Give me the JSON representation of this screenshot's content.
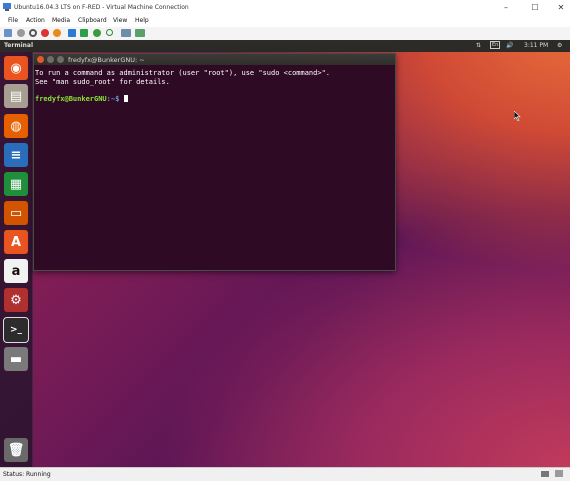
{
  "window": {
    "title": "Ubuntu16.04.3 LTS on F-RED - Virtual Machine Connection",
    "minimize": "–",
    "maximize": "☐",
    "close": "✕"
  },
  "menu": [
    "File",
    "Action",
    "Media",
    "Clipboard",
    "View",
    "Help"
  ],
  "guest_panel": {
    "app_name": "Terminal",
    "keyboard_layout": "En",
    "time": "3:11 PM",
    "network_glyph": "⇅",
    "volume_glyph": "🔊",
    "gear_glyph": "⚙"
  },
  "terminal": {
    "title": "fredyfx@BunkerGNU: ~",
    "line1": "To run a command as administrator (user \"root\"), use \"sudo <command>\".",
    "line2": "See \"man sudo_root\" for details.",
    "prompt_user": "fredyfx@BunkerGNU",
    "prompt_path": ":~$"
  },
  "launcher": [
    {
      "name": "ubuntu-dash",
      "glyph": "◉",
      "color": "#e95420"
    },
    {
      "name": "files",
      "glyph": "▤",
      "color": "#a89f93"
    },
    {
      "name": "firefox",
      "glyph": "◍",
      "color": "#e66000"
    },
    {
      "name": "writer",
      "glyph": "≡",
      "color": "#2a6ebb"
    },
    {
      "name": "calc",
      "glyph": "▦",
      "color": "#1f8f3a"
    },
    {
      "name": "impress",
      "glyph": "▭",
      "color": "#d35400"
    },
    {
      "name": "software",
      "glyph": "A",
      "color": "#e95420"
    },
    {
      "name": "amazon",
      "glyph": "a",
      "color": "#f2f2f2"
    },
    {
      "name": "settings",
      "glyph": "⚙",
      "color": "#b03030"
    },
    {
      "name": "terminal",
      "glyph": ">_",
      "color": "#2c2c2c"
    },
    {
      "name": "drive",
      "glyph": "▬",
      "color": "#7a7a7a"
    }
  ],
  "trash_glyph": "🗑",
  "status": {
    "text": "Status: Running"
  },
  "colors": {
    "ubuntu_orange": "#e95420",
    "terminal_bg": "#2f0a24",
    "prompt_green": "#8ae234",
    "prompt_blue": "#729fcf"
  }
}
